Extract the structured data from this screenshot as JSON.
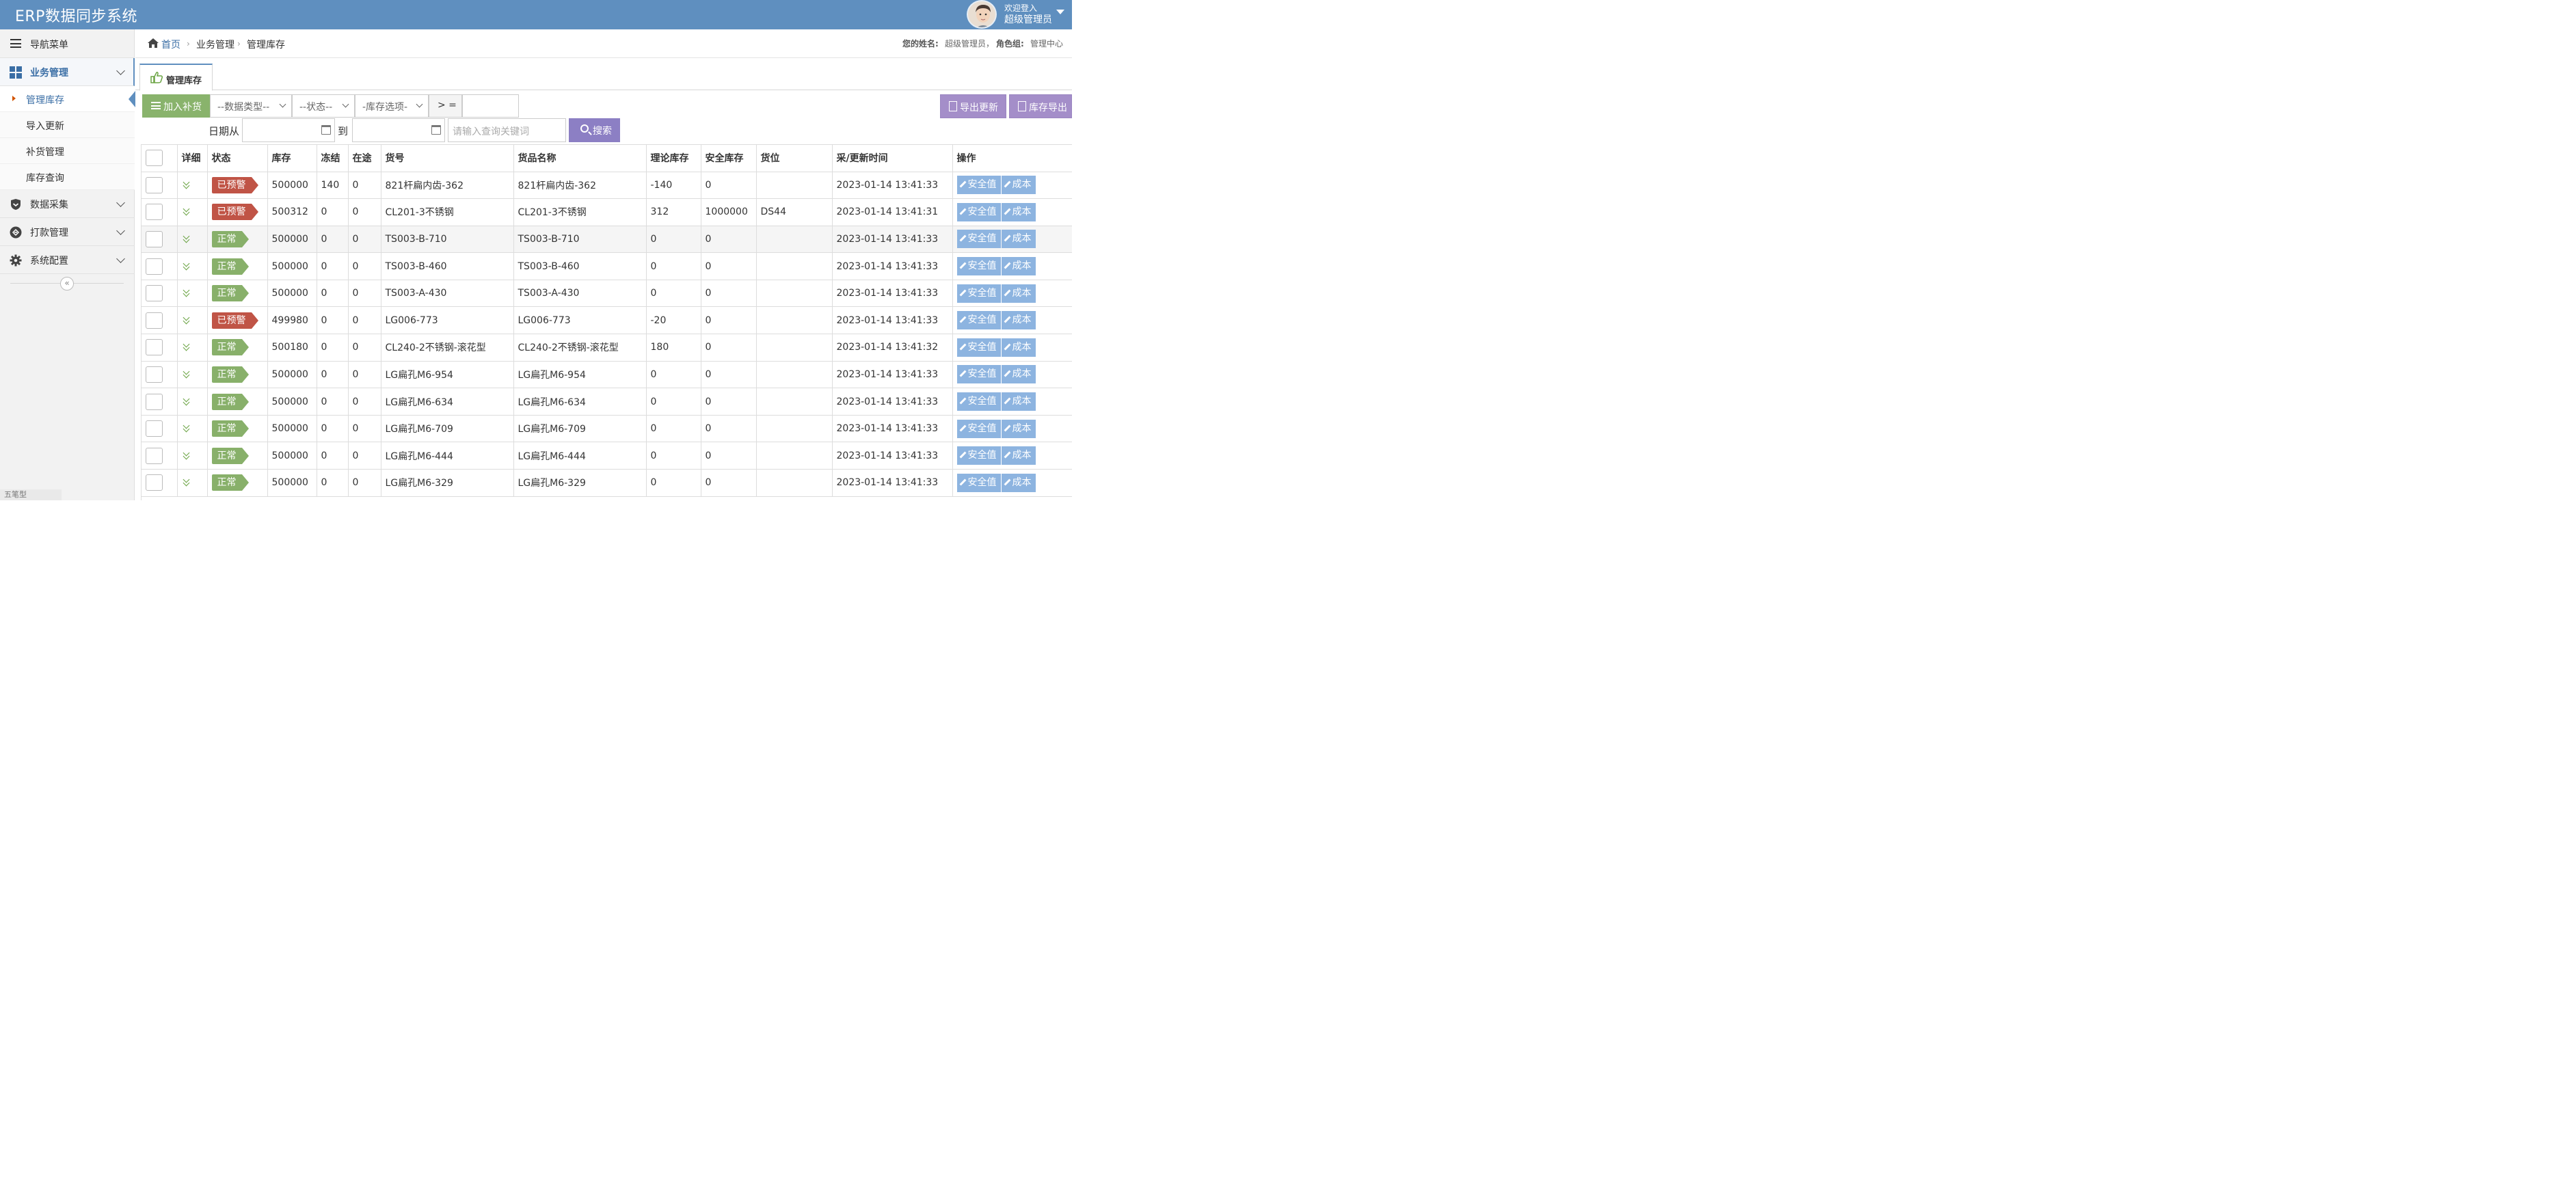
{
  "app": {
    "title": "ERP数据同步系统"
  },
  "user": {
    "welcome": "欢迎登入",
    "name": "超级管理员"
  },
  "sidebar": {
    "nav_title": "导航菜单",
    "groups": [
      {
        "label": "业务管理",
        "icon": "dashboard-icon"
      },
      {
        "label": "数据采集",
        "icon": "shield-icon"
      },
      {
        "label": "打款管理",
        "icon": "payment-icon"
      },
      {
        "label": "系统配置",
        "icon": "gear-icon"
      }
    ],
    "sub_items": [
      {
        "label": "管理库存"
      },
      {
        "label": "导入更新"
      },
      {
        "label": "补货管理"
      },
      {
        "label": "库存查询"
      }
    ],
    "collapse_glyph": "«"
  },
  "breadcrumb": {
    "home": "首页",
    "level2": "业务管理",
    "level3": "管理库存",
    "sep": "›"
  },
  "userinfo": {
    "name_label": "您的姓名:",
    "name_value": "超级管理员，",
    "role_label": "角色组:",
    "role_value": "管理中心"
  },
  "tab": {
    "label": "管理库存"
  },
  "toolbar": {
    "add_label": "加入补货",
    "data_type": "--数据类型--",
    "status": "--状态--",
    "stock_option": "-库存选项-",
    "operator": "> =",
    "date_from": "日期从",
    "date_to": "到",
    "keyword_placeholder": "请输入查询关键词",
    "search_label": "搜索",
    "export_update": "导出更新",
    "export_stock": "库存导出"
  },
  "table": {
    "headers": [
      "",
      "详细",
      "状态",
      "库存",
      "冻结",
      "在途",
      "货号",
      "货品名称",
      "理论库存",
      "安全库存",
      "货位",
      "采/更新时间",
      "操作"
    ],
    "action_safe": "安全值",
    "action_cost": "成本",
    "rows": [
      {
        "status": "已预警",
        "stock": "500000",
        "frozen": "140",
        "transit": "0",
        "sku": "821杆扁内齿-362",
        "name": "821杆扁内齿-362",
        "theory": "-140",
        "safe": "0",
        "loc": "",
        "time": "2023-01-14 13:41:33"
      },
      {
        "status": "已预警",
        "stock": "500312",
        "frozen": "0",
        "transit": "0",
        "sku": "CL201-3不锈钢",
        "name": "CL201-3不锈钢",
        "theory": "312",
        "safe": "1000000",
        "loc": "DS44",
        "time": "2023-01-14 13:41:31"
      },
      {
        "status": "正常",
        "stock": "500000",
        "frozen": "0",
        "transit": "0",
        "sku": "TS003-B-710",
        "name": "TS003-B-710",
        "theory": "0",
        "safe": "0",
        "loc": "",
        "time": "2023-01-14 13:41:33"
      },
      {
        "status": "正常",
        "stock": "500000",
        "frozen": "0",
        "transit": "0",
        "sku": "TS003-B-460",
        "name": "TS003-B-460",
        "theory": "0",
        "safe": "0",
        "loc": "",
        "time": "2023-01-14 13:41:33"
      },
      {
        "status": "正常",
        "stock": "500000",
        "frozen": "0",
        "transit": "0",
        "sku": "TS003-A-430",
        "name": "TS003-A-430",
        "theory": "0",
        "safe": "0",
        "loc": "",
        "time": "2023-01-14 13:41:33"
      },
      {
        "status": "已预警",
        "stock": "499980",
        "frozen": "0",
        "transit": "0",
        "sku": "LG006-773",
        "name": "LG006-773",
        "theory": "-20",
        "safe": "0",
        "loc": "",
        "time": "2023-01-14 13:41:33"
      },
      {
        "status": "正常",
        "stock": "500180",
        "frozen": "0",
        "transit": "0",
        "sku": "CL240-2不锈钢-滚花型",
        "name": "CL240-2不锈钢-滚花型",
        "theory": "180",
        "safe": "0",
        "loc": "",
        "time": "2023-01-14 13:41:32"
      },
      {
        "status": "正常",
        "stock": "500000",
        "frozen": "0",
        "transit": "0",
        "sku": "LG扁孔M6-954",
        "name": "LG扁孔M6-954",
        "theory": "0",
        "safe": "0",
        "loc": "",
        "time": "2023-01-14 13:41:33"
      },
      {
        "status": "正常",
        "stock": "500000",
        "frozen": "0",
        "transit": "0",
        "sku": "LG扁孔M6-634",
        "name": "LG扁孔M6-634",
        "theory": "0",
        "safe": "0",
        "loc": "",
        "time": "2023-01-14 13:41:33"
      },
      {
        "status": "正常",
        "stock": "500000",
        "frozen": "0",
        "transit": "0",
        "sku": "LG扁孔M6-709",
        "name": "LG扁孔M6-709",
        "theory": "0",
        "safe": "0",
        "loc": "",
        "time": "2023-01-14 13:41:33"
      },
      {
        "status": "正常",
        "stock": "500000",
        "frozen": "0",
        "transit": "0",
        "sku": "LG扁孔M6-444",
        "name": "LG扁孔M6-444",
        "theory": "0",
        "safe": "0",
        "loc": "",
        "time": "2023-01-14 13:41:33"
      },
      {
        "status": "正常",
        "stock": "500000",
        "frozen": "0",
        "transit": "0",
        "sku": "LG扁孔M6-329",
        "name": "LG扁孔M6-329",
        "theory": "0",
        "safe": "0",
        "loc": "",
        "time": "2023-01-14 13:41:33"
      }
    ]
  },
  "ime": {
    "label": "五笔型"
  },
  "colors": {
    "header": "#5f8fbf",
    "warn": "#c05446",
    "ok": "#88b06a",
    "action": "#8db4e0",
    "accent_purple": "#8c7fc4"
  }
}
